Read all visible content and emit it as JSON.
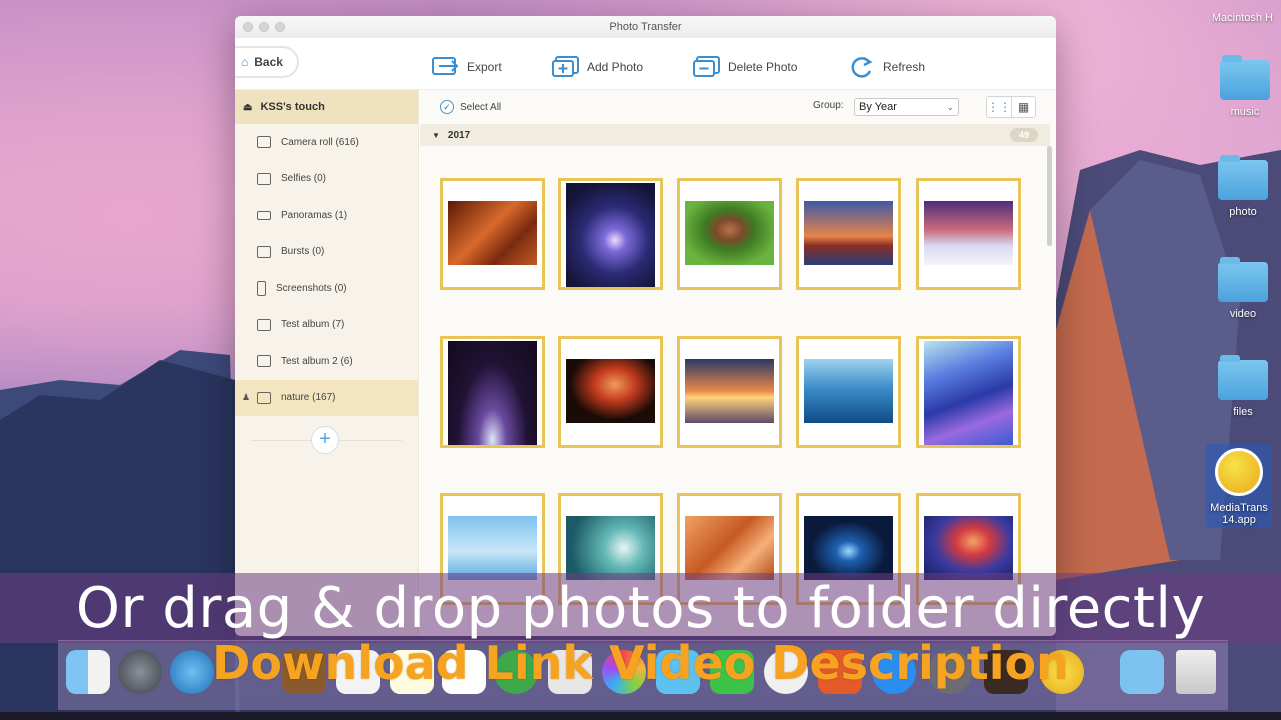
{
  "desktop": {
    "menubar_text": "Macintosh H",
    "icons": [
      {
        "label": "music"
      },
      {
        "label": "photo"
      },
      {
        "label": "video"
      },
      {
        "label": "files"
      },
      {
        "label": "MediaTrans 14.app"
      }
    ]
  },
  "window": {
    "title": "Photo Transfer",
    "back_label": "Back",
    "toolbar": {
      "export": "Export",
      "add_photo": "Add Photo",
      "delete_photo": "Delete Photo",
      "refresh": "Refresh"
    },
    "sidebar": {
      "device": "KSS's touch",
      "albums": [
        {
          "label": "Camera roll (616)",
          "icon": "camera-icon"
        },
        {
          "label": "Selfies (0)",
          "icon": "selfie-icon"
        },
        {
          "label": "Panoramas (1)",
          "icon": "panorama-icon"
        },
        {
          "label": "Bursts (0)",
          "icon": "bursts-icon"
        },
        {
          "label": "Screenshots (0)",
          "icon": "phone-icon"
        },
        {
          "label": "Test album  (7)",
          "icon": "album-icon"
        },
        {
          "label": "Test album 2 (6)",
          "icon": "album-icon"
        },
        {
          "label": "nature (167)",
          "icon": "album-icon"
        }
      ]
    },
    "content": {
      "select_all": "Select All",
      "group_label": "Group:",
      "group_value": "By Year",
      "year": "2017",
      "count": "49"
    }
  },
  "overlay": {
    "caption": "Or drag & drop photos to folder directly",
    "promo": "Download Link Video Description"
  }
}
